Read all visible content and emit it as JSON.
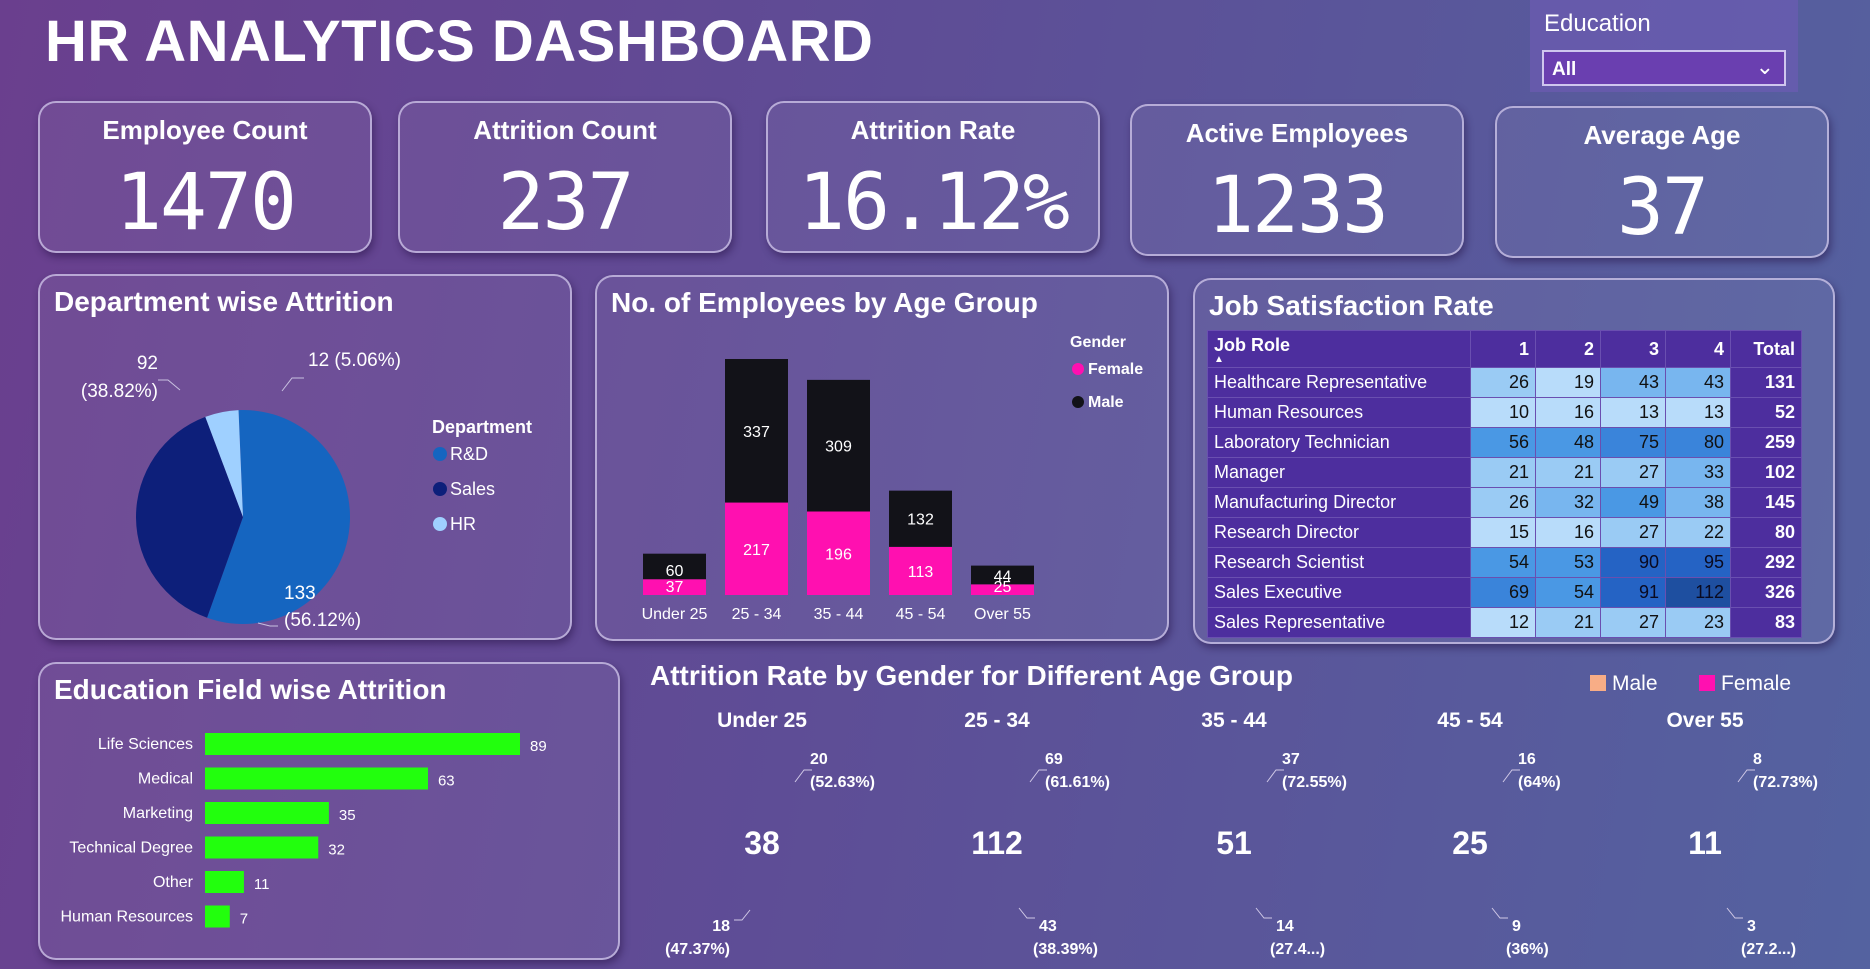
{
  "header": {
    "title": "HR ANALYTICS DASHBOARD"
  },
  "slicer": {
    "label": "Education",
    "value": "All"
  },
  "kpis": [
    {
      "label": "Employee Count",
      "value": "1470"
    },
    {
      "label": "Attrition Count",
      "value": "237"
    },
    {
      "label": "Attrition Rate",
      "value": "16.12%"
    },
    {
      "label": "Active Employees",
      "value": "1233"
    },
    {
      "label": "Average Age",
      "value": "37"
    }
  ],
  "colors": {
    "rd": "#1565c0",
    "sales": "#0d1f7a",
    "hr": "#9fd0ff",
    "female": "#ff10b0",
    "male_bar": "#121218",
    "male_donut": "#f8ad86",
    "edu_bar": "#22ff0d"
  },
  "chart_data": [
    {
      "id": "department",
      "type": "pie",
      "title": "Department wise Attrition",
      "legend_title": "Department",
      "legend_position": "right",
      "slices": [
        {
          "name": "R&D",
          "value": 133,
          "label": "133",
          "pct": "(56.12%)"
        },
        {
          "name": "Sales",
          "value": 92,
          "label": "92",
          "pct": "(38.82%)"
        },
        {
          "name": "HR",
          "value": 12,
          "label": "12 (5.06%)",
          "pct": ""
        }
      ]
    },
    {
      "id": "age_group",
      "type": "bar",
      "stacked": true,
      "title": "No. of Employees by Age Group",
      "legend_title": "Gender",
      "legend_position": "right",
      "categories": [
        "Under 25",
        "25 - 34",
        "35 - 44",
        "45 - 54",
        "Over 55"
      ],
      "series": [
        {
          "name": "Female",
          "values": [
            37,
            217,
            196,
            113,
            25
          ]
        },
        {
          "name": "Male",
          "values": [
            60,
            337,
            309,
            132,
            44
          ]
        }
      ],
      "ylim": [
        0,
        600
      ]
    },
    {
      "id": "job_satisfaction",
      "type": "table",
      "title": "Job Satisfaction Rate",
      "columns": [
        "Job Role",
        "1",
        "2",
        "3",
        "4",
        "Total"
      ],
      "rows": [
        [
          "Healthcare Representative",
          26,
          19,
          43,
          43,
          131
        ],
        [
          "Human Resources",
          10,
          16,
          13,
          13,
          52
        ],
        [
          "Laboratory Technician",
          56,
          48,
          75,
          80,
          259
        ],
        [
          "Manager",
          21,
          21,
          27,
          33,
          102
        ],
        [
          "Manufacturing Director",
          26,
          32,
          49,
          38,
          145
        ],
        [
          "Research Director",
          15,
          16,
          27,
          22,
          80
        ],
        [
          "Research Scientist",
          54,
          53,
          90,
          95,
          292
        ],
        [
          "Sales Executive",
          69,
          54,
          91,
          112,
          326
        ],
        [
          "Sales Representative",
          12,
          21,
          27,
          23,
          83
        ]
      ]
    },
    {
      "id": "education_field",
      "type": "bar",
      "orientation": "horizontal",
      "title": "Education Field wise Attrition",
      "categories": [
        "Life Sciences",
        "Medical",
        "Marketing",
        "Technical Degree",
        "Other",
        "Human Resources"
      ],
      "values": [
        89,
        63,
        35,
        32,
        11,
        7
      ]
    },
    {
      "id": "gender_age_attrition",
      "type": "pie",
      "variant": "donut",
      "title": "Attrition Rate by Gender for Different Age Group",
      "legend": [
        "Male",
        "Female"
      ],
      "legend_position": "top-right",
      "groups": [
        {
          "name": "Under 25",
          "total": 38,
          "male": 20,
          "male_label": "20",
          "male_pct": "(52.63%)",
          "female": 18,
          "female_label": "18",
          "female_pct": "(47.37%)"
        },
        {
          "name": "25 - 34",
          "total": 112,
          "male": 69,
          "male_label": "69",
          "male_pct": "(61.61%)",
          "female": 43,
          "female_label": "43",
          "female_pct": "(38.39%)"
        },
        {
          "name": "35 - 44",
          "total": 51,
          "male": 37,
          "male_label": "37",
          "male_pct": "(72.55%)",
          "female": 14,
          "female_label": "14",
          "female_pct": "(27.4...)"
        },
        {
          "name": "45 - 54",
          "total": 25,
          "male": 16,
          "male_label": "16",
          "male_pct": "(64%)",
          "female": 9,
          "female_label": "9",
          "female_pct": "(36%)"
        },
        {
          "name": "Over 55",
          "total": 11,
          "male": 8,
          "male_label": "8",
          "male_pct": "(72.73%)",
          "female": 3,
          "female_label": "3",
          "female_pct": "(27.2...)"
        }
      ]
    }
  ]
}
